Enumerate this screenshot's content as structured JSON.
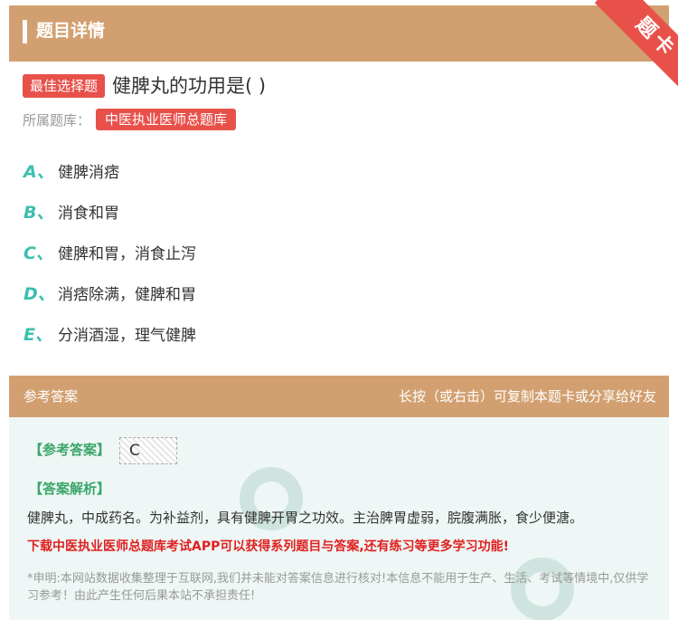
{
  "header": {
    "title": "题目详情"
  },
  "ribbon": {
    "label": "题卡"
  },
  "question": {
    "tag": "最佳选择题",
    "text": "健脾丸的功用是( )",
    "library_label": "所属题库：",
    "library_name": "中医执业医师总题库"
  },
  "options": [
    {
      "letter": "A、",
      "text": "健脾消痞"
    },
    {
      "letter": "B、",
      "text": "消食和胃"
    },
    {
      "letter": "C、",
      "text": "健脾和胃，消食止泻"
    },
    {
      "letter": "D、",
      "text": "消痞除满，健脾和胃"
    },
    {
      "letter": "E、",
      "text": "分消酒湿，理气健脾"
    }
  ],
  "answer_bar": {
    "left": "参考答案",
    "right": "长按（或右击）可复制本题卡或分享给好友"
  },
  "answer": {
    "label": "【参考答案】",
    "value": "C",
    "explanation_label": "【答案解析】",
    "explanation": "健脾丸，中成药名。为补益剂，具有健脾开胃之功效。主治脾胃虚弱，脘腹满胀，食少便溏。",
    "promo": "下载中医执业医师总题库考试APP可以获得系列题目与答案,还有练习等更多学习功能!",
    "disclaimer": "*申明:本网站数据收集整理于互联网,我们并未能对答案信息进行核对!本信息不能用于生产、生活、考试等情境中,仅供学习参考！由此产生任何后果本站不承担责任!"
  },
  "colors": {
    "accent": "#d2a070",
    "tag_red": "#e8514a",
    "option_letter": "#3bbfb0",
    "answer_green": "#3aa66a"
  }
}
